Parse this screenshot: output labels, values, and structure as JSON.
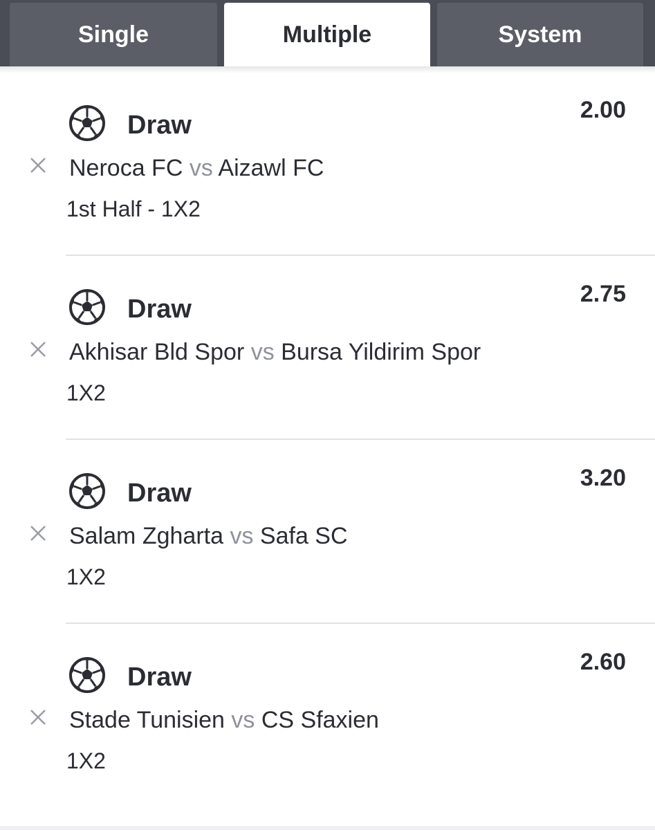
{
  "tabs": [
    {
      "label": "Single",
      "active": false
    },
    {
      "label": "Multiple",
      "active": true
    },
    {
      "label": "System",
      "active": false
    }
  ],
  "bets": [
    {
      "selection": "Draw",
      "home": "Neroca FC",
      "vs": "vs",
      "away": "Aizawl FC",
      "market": "1st Half - 1X2",
      "odds": "2.00",
      "icon": "soccer-ball-icon"
    },
    {
      "selection": "Draw",
      "home": "Akhisar Bld Spor",
      "vs": "vs",
      "away": "Bursa Yildirim Spor",
      "market": "1X2",
      "odds": "2.75",
      "icon": "soccer-ball-icon"
    },
    {
      "selection": "Draw",
      "home": "Salam Zgharta",
      "vs": "vs",
      "away": "Safa SC",
      "market": "1X2",
      "odds": "3.20",
      "icon": "soccer-ball-icon"
    },
    {
      "selection": "Draw",
      "home": "Stade Tunisien",
      "vs": "vs",
      "away": "CS Sfaxien",
      "market": "1X2",
      "odds": "2.60",
      "icon": "soccer-ball-icon"
    }
  ],
  "colors": {
    "tabbar": "#4a4d55",
    "tab_inactive": "#5b5e66",
    "text": "#2b2d33",
    "muted": "#8f929a",
    "divider": "#e2e2e4"
  }
}
